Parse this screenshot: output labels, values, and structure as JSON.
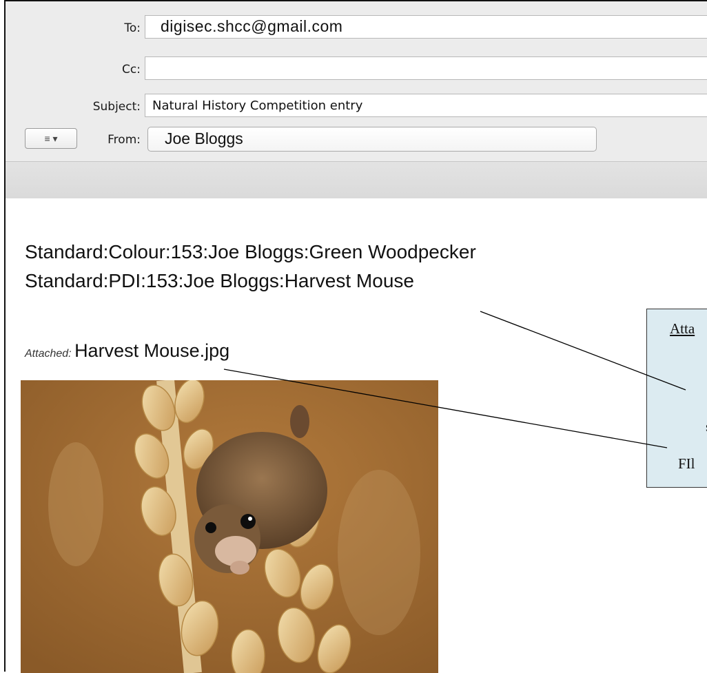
{
  "header": {
    "to_label": "To:",
    "to_value": "digisec.shcc@gmail.com",
    "cc_label": "Cc:",
    "cc_value": "",
    "subject_label": "Subject:",
    "subject_value": "Natural History Competition entry",
    "from_label": "From:",
    "from_value": "Joe Bloggs",
    "menu_button": "≡ ▾"
  },
  "body": {
    "line1": "Standard:Colour:153:Joe Bloggs:Green Woodpecker",
    "line2": "Standard:PDI:153:Joe Bloggs:Harvest Mouse",
    "attached_label": "Attached:",
    "attached_filename": "Harvest Mouse.jpg"
  },
  "callout": {
    "heading": "Atta",
    "line_s": "s",
    "line_fi": "FIl"
  },
  "colors": {
    "header_bg": "#ececec",
    "callout_bg": "#dcebf1"
  }
}
